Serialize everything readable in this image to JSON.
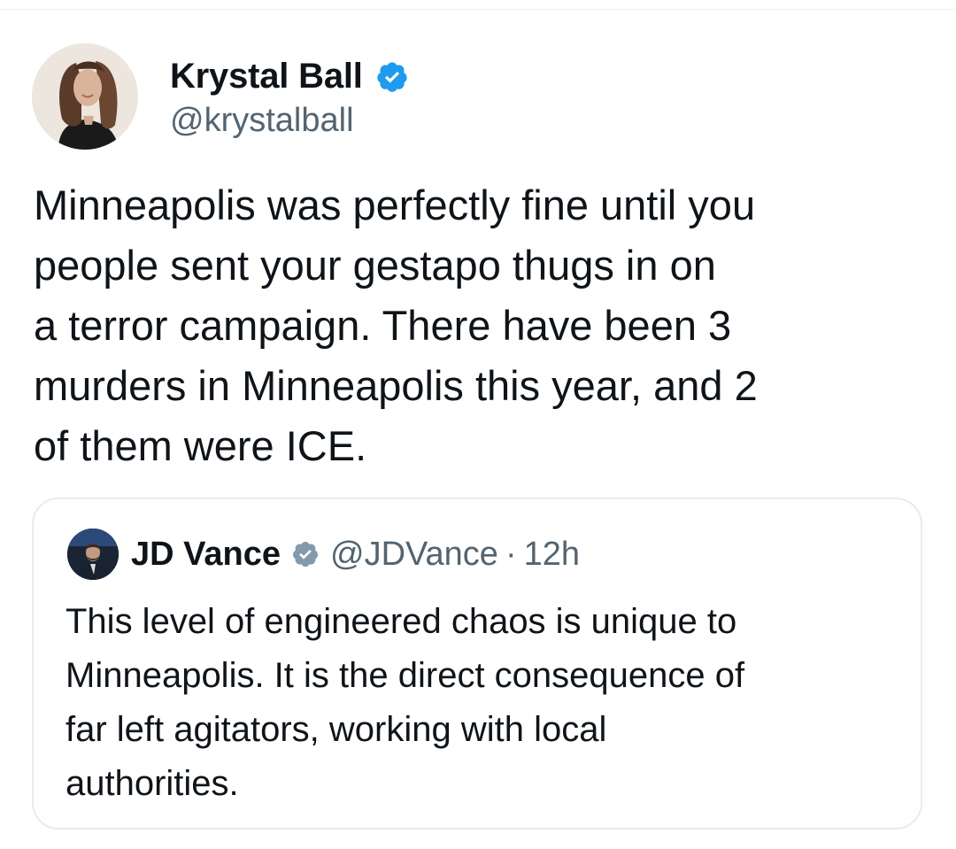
{
  "tweet": {
    "author": {
      "display_name": "Krystal Ball",
      "handle": "@krystalball",
      "verified": true,
      "verified_color": "#1d9bf0",
      "avatar_icon": "profile-photo"
    },
    "text": "Minneapolis was perfectly fine until you\npeople sent your gestapo thugs in on\na terror campaign. There have been 3\nmurders in Minneapolis this year, and 2\nof them were ICE.",
    "quoted_tweet": {
      "author": {
        "display_name": "JD Vance",
        "handle": "@JDVance",
        "verified": true,
        "verified_color": "#829aab",
        "avatar_icon": "profile-photo"
      },
      "separator": "·",
      "time": "12h",
      "text": "This level of engineered chaos is unique to\nMinneapolis. It is the direct consequence of\nfar left agitators, working with local\nauthorities."
    }
  },
  "colors": {
    "text_primary": "#0f1419",
    "text_secondary": "#536471",
    "border": "#e7ecef"
  }
}
